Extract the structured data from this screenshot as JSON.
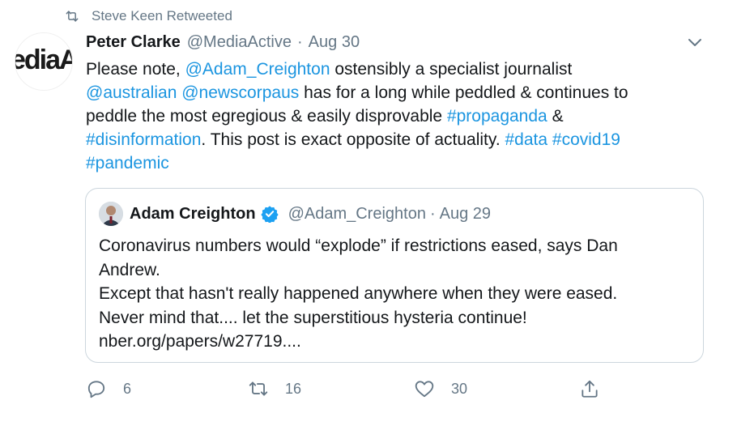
{
  "retweet": {
    "label": "Steve Keen Retweeted",
    "icon": "retweet-icon"
  },
  "tweet": {
    "author_name": "Peter Clarke",
    "author_handle": "@MediaActive",
    "separator": "·",
    "date": "Aug 30",
    "avatar_text": "ediaActi",
    "lines": [
      [
        {
          "t": "Please note, ",
          "link": false
        },
        {
          "t": "@Adam_Creighton",
          "link": true
        },
        {
          "t": " ostensibly a specialist journalist",
          "link": false
        }
      ],
      [
        {
          "t": "@australian",
          "link": true
        },
        {
          "t": " ",
          "link": false
        },
        {
          "t": "@newscorpaus",
          "link": true
        },
        {
          "t": " has for a long while peddled & continues to",
          "link": false
        }
      ],
      [
        {
          "t": "peddle the most egregious & easily disprovable ",
          "link": false
        },
        {
          "t": "#propaganda",
          "link": true
        },
        {
          "t": " &",
          "link": false
        }
      ],
      [
        {
          "t": "#disinformation",
          "link": true
        },
        {
          "t": ". This post is exact opposite of actuality. ",
          "link": false
        },
        {
          "t": "#data",
          "link": true
        },
        {
          "t": " ",
          "link": false
        },
        {
          "t": "#covid19",
          "link": true
        }
      ],
      [
        {
          "t": "#pandemic",
          "link": true
        }
      ]
    ]
  },
  "quote": {
    "author_name": "Adam Creighton",
    "author_handle": "@Adam_Creighton",
    "separator": "·",
    "date": "Aug 29",
    "verified": true,
    "lines": [
      "Coronavirus numbers would “explode” if restrictions eased, says Dan",
      "Andrew.",
      "Except that hasn't really happened anywhere when they were eased.",
      "Never mind that.... let the superstitious hysteria continue!",
      "nber.org/papers/w27719...."
    ]
  },
  "actions": {
    "reply": {
      "count": "6",
      "icon": "reply-icon"
    },
    "retweet": {
      "count": "16",
      "icon": "retweet-icon"
    },
    "like": {
      "count": "30",
      "icon": "heart-icon"
    },
    "share": {
      "icon": "share-icon"
    }
  },
  "colors": {
    "link": "#1b95e0",
    "secondary": "#657786",
    "border": "#ccd6dd",
    "verified": "#1da1f2"
  }
}
